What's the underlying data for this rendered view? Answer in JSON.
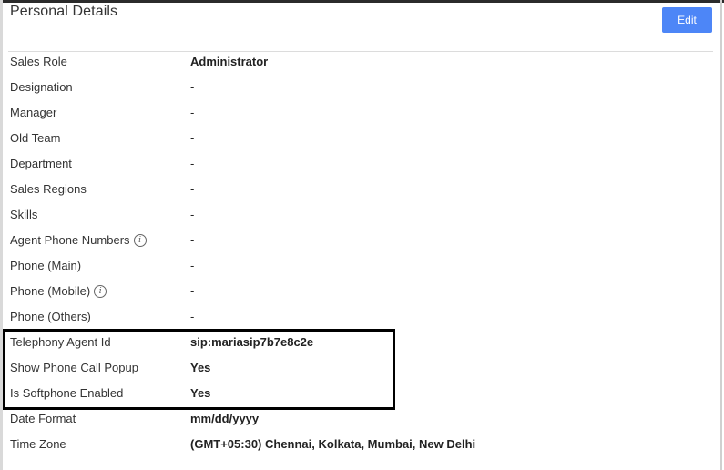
{
  "header": {
    "title": "Personal Details",
    "edit_label": "Edit"
  },
  "rows": [
    {
      "label": "Sales Role",
      "value": "Administrator",
      "bold": true
    },
    {
      "label": "Designation",
      "value": "-"
    },
    {
      "label": "Manager",
      "value": "-"
    },
    {
      "label": "Old Team",
      "value": "-"
    },
    {
      "label": "Department",
      "value": "-"
    },
    {
      "label": "Sales Regions",
      "value": "-"
    },
    {
      "label": "Skills",
      "value": "-"
    },
    {
      "label": "Agent Phone Numbers",
      "value": "-",
      "info": true
    },
    {
      "label": "Phone (Main)",
      "value": "-"
    },
    {
      "label": "Phone (Mobile)",
      "value": "-",
      "info": true
    },
    {
      "label": "Phone (Others)",
      "value": "-"
    },
    {
      "label": "Telephony Agent Id",
      "value": "sip:mariasip7b7e8c2e",
      "bold": true
    },
    {
      "label": "Show Phone Call Popup",
      "value": "Yes",
      "bold": true
    },
    {
      "label": "Is Softphone Enabled",
      "value": "Yes",
      "bold": true
    },
    {
      "label": "Date Format",
      "value": "mm/dd/yyyy",
      "bold": true
    },
    {
      "label": "Time Zone",
      "value": "(GMT+05:30) Chennai, Kolkata, Mumbai, New Delhi",
      "bold": true
    }
  ],
  "icons": {
    "info": "info-icon"
  },
  "colors": {
    "accent": "#4d86f7",
    "highlight_border": "#000000"
  }
}
